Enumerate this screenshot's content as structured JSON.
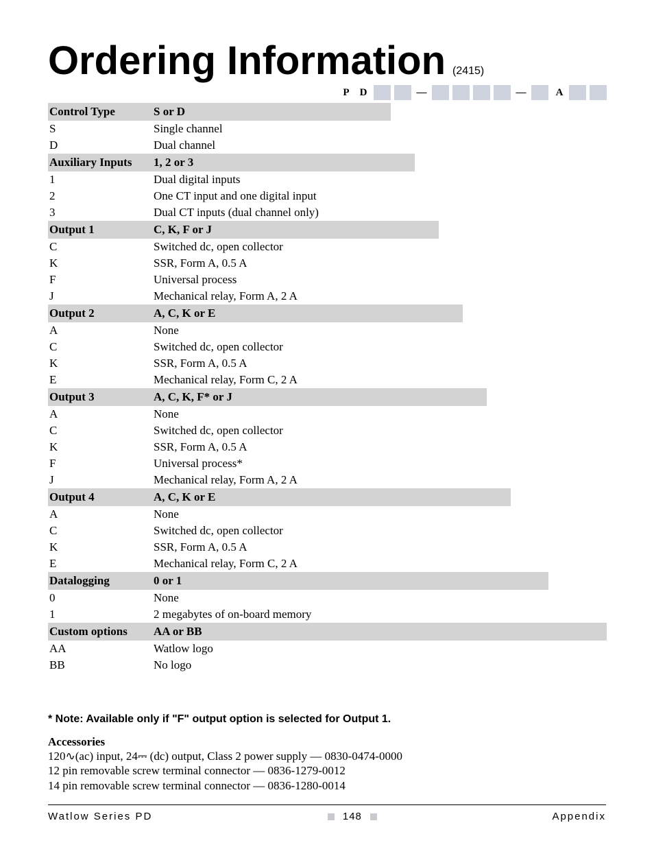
{
  "title": "Ordering Information",
  "title_code": "(2415)",
  "code_strip": {
    "P": "P",
    "D": "D",
    "dash": "—",
    "A": "A"
  },
  "sections": [
    {
      "head_code": "Control Type",
      "head_desc": "S or D",
      "rows": [
        {
          "code": "S",
          "desc": "Single channel"
        },
        {
          "code": "D",
          "desc": "Dual channel"
        }
      ]
    },
    {
      "head_code": "Auxiliary Inputs",
      "head_desc": "1, 2 or 3",
      "rows": [
        {
          "code": "1",
          "desc": "Dual digital inputs"
        },
        {
          "code": "2",
          "desc": "One CT input and one digital input"
        },
        {
          "code": "3",
          "desc": "Dual CT inputs (dual channel only)"
        }
      ]
    },
    {
      "head_code": "Output 1",
      "head_desc": "C, K, F or J",
      "rows": [
        {
          "code": "C",
          "desc": "Switched dc, open collector"
        },
        {
          "code": "K",
          "desc": "SSR, Form A, 0.5 A"
        },
        {
          "code": "F",
          "desc": "Universal process"
        },
        {
          "code": "J",
          "desc": "Mechanical relay, Form A, 2 A"
        }
      ]
    },
    {
      "head_code": "Output 2",
      "head_desc": "A, C, K or E",
      "rows": [
        {
          "code": "A",
          "desc": "None"
        },
        {
          "code": "C",
          "desc": "Switched dc, open collector"
        },
        {
          "code": "K",
          "desc": "SSR, Form A, 0.5 A"
        },
        {
          "code": "E",
          "desc": "Mechanical relay, Form C, 2 A"
        }
      ]
    },
    {
      "head_code": "Output 3",
      "head_desc": "A, C, K, F* or J",
      "rows": [
        {
          "code": "A",
          "desc": "None"
        },
        {
          "code": "C",
          "desc": "Switched dc, open collector"
        },
        {
          "code": "K",
          "desc": "SSR, Form A, 0.5 A"
        },
        {
          "code": "F",
          "desc": "Universal process*"
        },
        {
          "code": "J",
          "desc": "Mechanical relay, Form A, 2 A"
        }
      ]
    },
    {
      "head_code": "Output 4",
      "head_desc": "A, C, K or E",
      "rows": [
        {
          "code": "A",
          "desc": "None"
        },
        {
          "code": "C",
          "desc": "Switched dc, open collector"
        },
        {
          "code": "K",
          "desc": "SSR, Form A, 0.5 A"
        },
        {
          "code": "E",
          "desc": "Mechanical relay, Form C, 2 A"
        }
      ]
    },
    {
      "head_code": "Datalogging",
      "head_desc": "0 or 1",
      "rows": [
        {
          "code": "0",
          "desc": "None"
        },
        {
          "code": "1",
          "desc": "2 megabytes of on-board memory"
        }
      ]
    },
    {
      "head_code": "Custom options",
      "head_desc": "AA or BB",
      "rows": [
        {
          "code": "AA",
          "desc": "Watlow logo"
        },
        {
          "code": "BB",
          "desc": "No logo"
        }
      ]
    }
  ],
  "note": "* Note: Available only if \"F\" output option is selected for Output 1.",
  "accessories": {
    "heading": "Accessories",
    "lines": [
      "120∿(ac) input, 24⎓ (dc) output, Class 2 power supply — 0830-0474-0000",
      "12 pin removable screw terminal connector — 0836-1279-0012",
      "14 pin removable screw terminal connector — 0836-1280-0014"
    ]
  },
  "footer": {
    "left": "Watlow Series PD",
    "page": "148",
    "right": "Appendix"
  }
}
